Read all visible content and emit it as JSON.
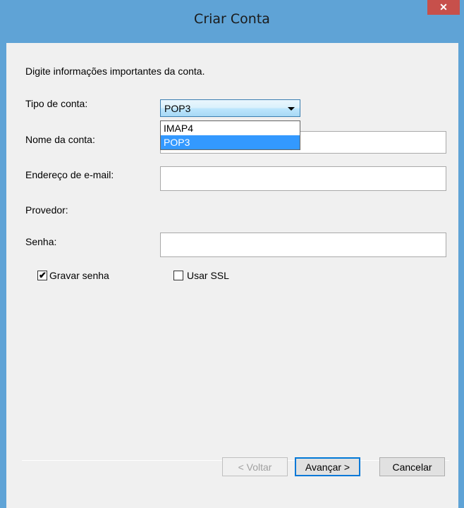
{
  "window": {
    "title": "Criar Conta",
    "close_label": "✕"
  },
  "form": {
    "intro": "Digite informações importantes da conta.",
    "account_type_label": "Tipo de conta:",
    "account_type_value": "POP3",
    "account_type_options": [
      "IMAP4",
      "POP3"
    ],
    "account_name_label": "Nome da conta:",
    "account_name_value": "",
    "email_label": "Endereço de e-mail:",
    "email_value": "",
    "provider_label": "Provedor:",
    "password_label": "Senha:",
    "password_value": "",
    "save_password_label": "Gravar senha",
    "save_password_checked": true,
    "use_ssl_label": "Usar SSL",
    "use_ssl_checked": false
  },
  "buttons": {
    "back": "< Voltar",
    "next": "Avançar >",
    "cancel": "Cancelar"
  },
  "colors": {
    "titlebar": "#5fa3d6",
    "close": "#c7504b",
    "selection": "#3399ff"
  }
}
